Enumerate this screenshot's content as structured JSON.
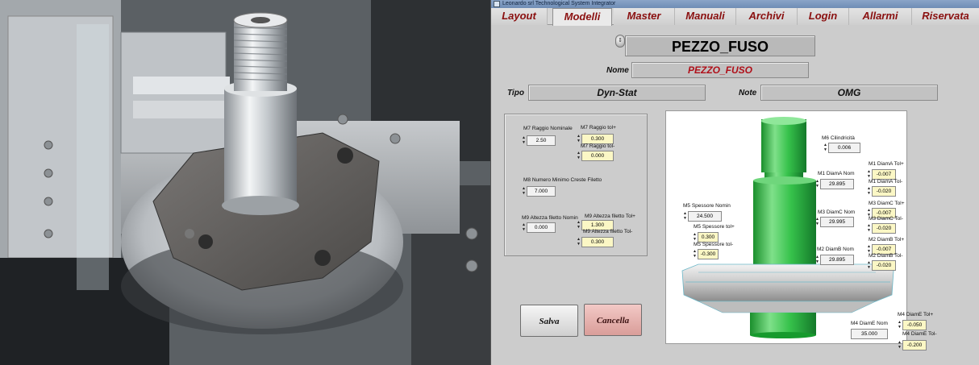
{
  "window": {
    "title": "Leonardo srl Technological System Integrator"
  },
  "tabs": [
    "Layout",
    "Modelli",
    "Master",
    "Manuali",
    "Archivi",
    "Login",
    "Allarmi",
    "Riservata"
  ],
  "active_tab": "Modelli",
  "model": {
    "title": "PEZZO_FUSO"
  },
  "fields": {
    "nome_label": "Nome",
    "nome_value": "PEZZO_FUSO",
    "tipo_label": "Tipo",
    "tipo_value": "Dyn-Stat",
    "note_label": "Note",
    "note_value": "OMG"
  },
  "params": {
    "m7_raggio_nominale": {
      "label": "M7 Raggio Nominale",
      "value": "2.50"
    },
    "m7_raggio_tol_plus": {
      "label": "M7 Raggio tol+",
      "value": "0.300"
    },
    "m7_raggio_tol_minus": {
      "label": "M7 Raggio tol-",
      "value": "0.000"
    },
    "m8_numero_minimo": {
      "label": "M8 Numero Minimo Creste Filetto",
      "value": "7.000"
    },
    "m9_altezza_nominale": {
      "label": "M9 Altezza filetto Nomin",
      "value": "0.000"
    },
    "m9_altezza_tol_plus": {
      "label": "M9 Altezza filetto Tol+",
      "value": "1.300"
    },
    "m9_altezza_tol_minus": {
      "label": "M9 Altezza filetto Tol-",
      "value": "0.300"
    },
    "m6_cilindricita": {
      "label": "M6 Cilindricità",
      "value": "0.006"
    },
    "m1_diama_nom": {
      "label": "M1 DiamA Nom",
      "value": "29.895"
    },
    "m1_diama_tol_plus": {
      "label": "M1 DiamA Tol+",
      "value": "-0.007"
    },
    "m1_diama_tol_minus": {
      "label": "M1 DiamA Tol-",
      "value": "-0.020"
    },
    "m3_diamc_nom": {
      "label": "M3 DiamC Nom",
      "value": "29.995"
    },
    "m3_diamc_tol_plus": {
      "label": "M3 DiamC Tol+",
      "value": "-0.007"
    },
    "m3_diamc_tol_minus": {
      "label": "M3 DiamC Tol-",
      "value": "-0.020"
    },
    "m5_spessore_nom": {
      "label": "M5 Spessore Nomin",
      "value": "24.500"
    },
    "m5_spessore_tol_plus": {
      "label": "M5 Spessore tol+",
      "value": "0.300"
    },
    "m5_spessore_tol_minus": {
      "label": "M5 Spessore tol-",
      "value": "-0.300"
    },
    "m2_diamb_nom": {
      "label": "M2 DiamB Nom",
      "value": "29.895"
    },
    "m2_diamb_tol_plus": {
      "label": "M2 DiamB Tol+",
      "value": "-0.007"
    },
    "m2_diamb_tol_minus": {
      "label": "M2 DiamB Tol-",
      "value": "-0.020"
    },
    "m4_diame_nom": {
      "label": "M4 DiamE Nom",
      "value": "35.000"
    },
    "m4_diame_tol_plus": {
      "label": "M4 DiamE Tol+",
      "value": "-0.050"
    },
    "m4_diame_tol_minus": {
      "label": "M4 DiamE Tol-",
      "value": "-0.200"
    }
  },
  "buttons": {
    "salva": "Salva",
    "cancella": "Cancella"
  },
  "colors": {
    "tab_text": "#8a1010",
    "name_text": "#b0101a",
    "tolerance_bg": "#fbf7c5",
    "part_green": "#33c24a"
  }
}
